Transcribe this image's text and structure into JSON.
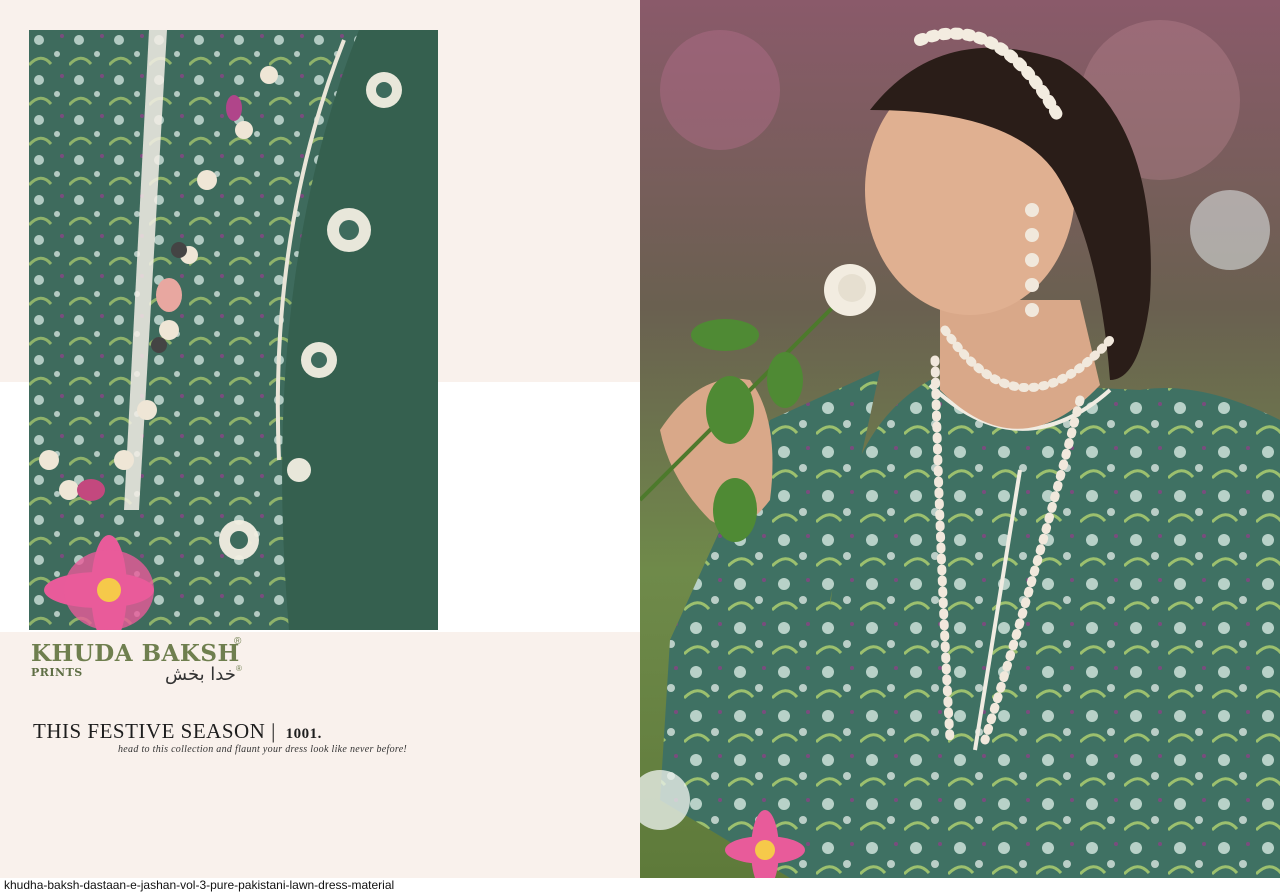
{
  "brand": {
    "name": "KHUDA BAKSH",
    "sub": "PRINTS",
    "urdu": "خدا بخش",
    "registered": "®"
  },
  "promo": {
    "headline": "THIS FESTIVE SEASON",
    "separator": "|",
    "design_number": "1001.",
    "tagline": "head to this collection and flaunt your dress look like never before!"
  },
  "caption": "khudha-baksh-dastaan-e-jashan-vol-3-pure-pakistani-lawn-dress-material",
  "colors": {
    "panel_background": "#f9f1ec",
    "fabric_green": "#3e6b5d",
    "fabric_green_light": "#5b8a7a",
    "brand_olive": "#6f7f4f"
  }
}
